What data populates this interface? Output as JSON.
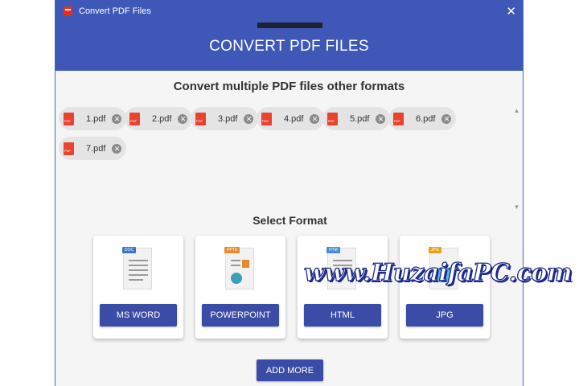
{
  "window": {
    "title": "Convert PDF Files"
  },
  "header": {
    "title": "CONVERT PDF FILES"
  },
  "subtitle": "Convert multiple PDF files other formats",
  "files": [
    {
      "label": "1.pdf"
    },
    {
      "label": "2.pdf"
    },
    {
      "label": "3.pdf"
    },
    {
      "label": "4.pdf"
    },
    {
      "label": "5.pdf"
    },
    {
      "label": "6.pdf"
    },
    {
      "label": "7.pdf"
    }
  ],
  "select_format": {
    "title": "Select Format",
    "options": [
      {
        "label": "MS WORD",
        "tag": "DOC",
        "tag_color": "#3d74c9",
        "icon": "word-document-icon"
      },
      {
        "label": "POWERPOINT",
        "tag": "PPTX",
        "tag_color": "#e58a2e",
        "icon": "powerpoint-document-icon"
      },
      {
        "label": "HTML",
        "tag": "HTM",
        "tag_color": "#4a8ad4",
        "icon": "html-document-icon"
      },
      {
        "label": "JPG",
        "tag": "JPG",
        "tag_color": "#e8a11f",
        "icon": "jpg-image-icon"
      }
    ]
  },
  "add_more_label": "ADD MORE",
  "watermark": "www.HuzaifaPC.com",
  "colors": {
    "primary": "#3f58b8",
    "button": "#3a4ca6",
    "pdf_red": "#e8432f"
  }
}
